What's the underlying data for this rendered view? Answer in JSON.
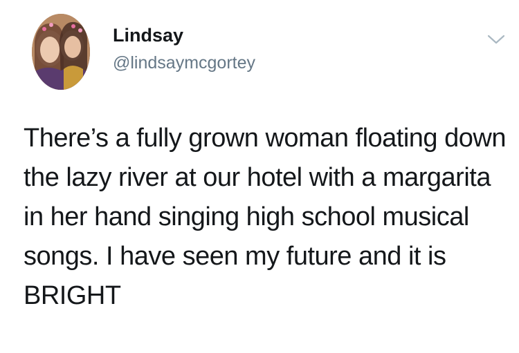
{
  "tweet": {
    "author_name": "Lindsay",
    "author_handle": "@lindsaymcgortey",
    "text": "There’s a fully grown woman floating down the lazy river at our hotel with a margarita in her hand singing high school musical songs. I have seen my future and it is BRIGHT"
  },
  "icons": {
    "avatar": "profile-photo",
    "menu": "chevron-down-icon"
  },
  "colors": {
    "name": "#14171a",
    "handle": "#657786",
    "caret": "#aab8c2"
  }
}
